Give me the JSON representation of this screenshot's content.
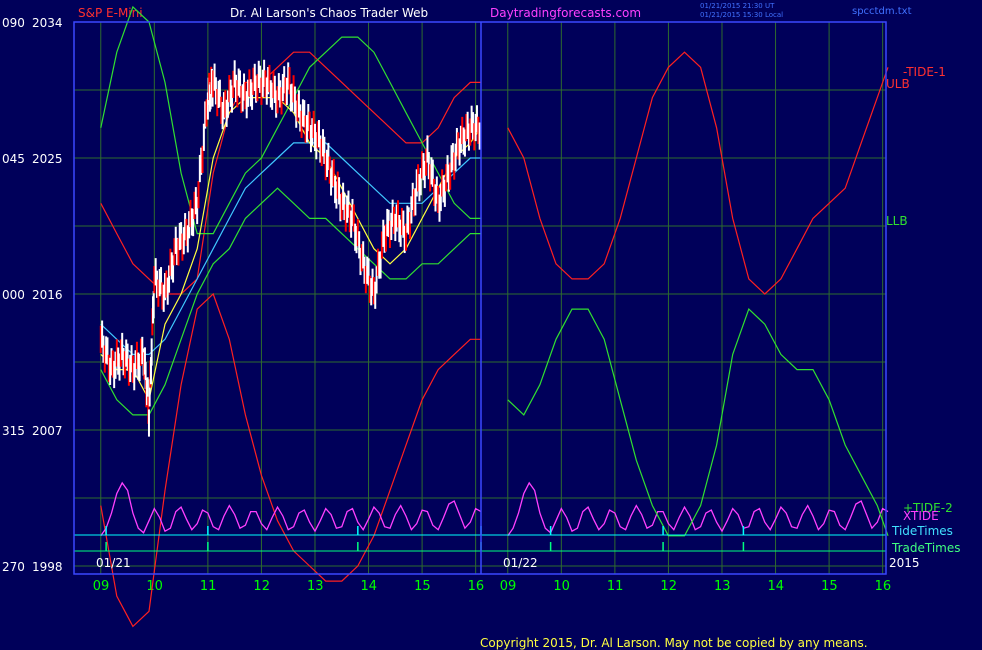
{
  "header": {
    "symbol": "S&P E-Mini",
    "title": "Dr. Al Larson's Chaos Trader Web",
    "site": "Daytradingforecasts.com",
    "timestamp_1": "01/21/2015 21:30 UT",
    "timestamp_2": "01/21/2015 15:30 Local",
    "file": "spcctdm.txt"
  },
  "copyright": "Copyright 2015, Dr. Al Larson. May not be copied by any means.",
  "colors": {
    "background": "#00005a",
    "grid": "#2e6b2e",
    "border": "#3a48ff",
    "price": "#ffffff",
    "down": "#ff0000",
    "red_line": "#ff2020",
    "green_line": "#30e030",
    "cyan_line": "#40c8ff",
    "yellow_line": "#ffff40",
    "magenta_line": "#ff40ff",
    "tide_times": "#00ffff",
    "trade_times": "#00ff80"
  },
  "chart_data": {
    "type": "line",
    "y_axis": {
      "price_ticks": [
        1998,
        2007,
        2016,
        2025,
        2034
      ],
      "angle_labels": [
        "270",
        "315",
        "000",
        "045",
        "090"
      ],
      "ylim": [
        1998,
        2034
      ]
    },
    "x_axis": {
      "hour_ticks": [
        "09",
        "10",
        "11",
        "12",
        "13",
        "14",
        "15",
        "16",
        "09",
        "10",
        "11",
        "12",
        "13",
        "14",
        "15",
        "16"
      ],
      "date_labels": [
        "01/21",
        "01/22"
      ],
      "year_label": "2015"
    },
    "series_labels": {
      "tide_1": "-TIDE-1",
      "ulb": "ULB",
      "llb": "LLB",
      "tide_2": "+TIDE-2",
      "xtide": "XTIDE",
      "tide_times": "TideTimes",
      "trade_times": "TradeTimes"
    },
    "series": [
      {
        "name": "-TIDE-1",
        "color": "#ff2020",
        "x": [
          9.0,
          9.3,
          9.6,
          9.9,
          10.2,
          10.5,
          10.8,
          11.1,
          11.4,
          11.7,
          12.0,
          12.3,
          12.6,
          12.9,
          13.2,
          13.5,
          13.8,
          14.1,
          14.4,
          14.7,
          15.0,
          15.3,
          15.6,
          15.9,
          16.1
        ],
        "values": [
          2002,
          1996,
          1994,
          1995,
          2003,
          2010,
          2015,
          2016,
          2013,
          2008,
          2004,
          2001,
          1999,
          1998,
          1997,
          1997,
          1998,
          2000,
          2003,
          2006,
          2009,
          2011,
          2012,
          2013,
          2013
        ]
      },
      {
        "name": "ULB",
        "color": "#ff2020",
        "x": [
          9.0,
          9.3,
          9.6,
          9.9,
          10.2,
          10.5,
          10.8,
          11.1,
          11.4,
          11.7,
          12.0,
          12.3,
          12.6,
          12.9,
          13.2,
          13.5,
          13.8,
          14.1,
          14.4,
          14.7,
          15.0,
          15.3,
          15.6,
          15.9,
          16.1
        ],
        "values": [
          2022,
          2020,
          2018,
          2017,
          2016,
          2016,
          2017,
          2024,
          2028,
          2030,
          2030,
          2031,
          2032,
          2032,
          2031,
          2030,
          2029,
          2028,
          2027,
          2026,
          2026,
          2027,
          2029,
          2030,
          2030
        ]
      },
      {
        "name": "LLB",
        "color": "#30e030",
        "x": [
          9.0,
          9.3,
          9.6,
          9.9,
          10.2,
          10.5,
          10.8,
          11.1,
          11.4,
          11.7,
          12.0,
          12.3,
          12.6,
          12.9,
          13.2,
          13.5,
          13.8,
          14.1,
          14.4,
          14.7,
          15.0,
          15.3,
          15.6,
          15.9,
          16.1
        ],
        "values": [
          2011,
          2009,
          2008,
          2008,
          2010,
          2013,
          2016,
          2018,
          2019,
          2021,
          2022,
          2023,
          2022,
          2021,
          2021,
          2020,
          2019,
          2018,
          2017,
          2017,
          2018,
          2018,
          2019,
          2020,
          2020
        ]
      },
      {
        "name": "+TIDE-2",
        "color": "#30e030",
        "x": [
          9.0,
          9.3,
          9.6,
          9.9,
          10.2,
          10.5,
          10.8,
          11.1,
          11.4,
          11.7,
          12.0,
          12.3,
          12.6,
          12.9,
          13.2,
          13.5,
          13.8,
          14.1,
          14.4,
          14.7,
          15.0,
          15.3,
          15.6,
          15.9,
          16.1
        ],
        "values": [
          2027,
          2032,
          2035,
          2034,
          2030,
          2024,
          2020,
          2020,
          2022,
          2024,
          2025,
          2027,
          2029,
          2031,
          2032,
          2033,
          2033,
          2032,
          2030,
          2028,
          2026,
          2024,
          2022,
          2021,
          2021
        ]
      },
      {
        "name": "Cyan",
        "color": "#40c8ff",
        "x": [
          9.0,
          9.3,
          9.6,
          9.9,
          10.2,
          10.5,
          10.8,
          11.1,
          11.4,
          11.7,
          12.0,
          12.3,
          12.6,
          12.9,
          13.2,
          13.5,
          13.8,
          14.1,
          14.4,
          14.7,
          15.0,
          15.3,
          15.6,
          15.9,
          16.1
        ],
        "values": [
          2014,
          2013,
          2012,
          2012,
          2013,
          2015,
          2017,
          2019,
          2021,
          2023,
          2024,
          2025,
          2026,
          2026,
          2026,
          2025,
          2024,
          2023,
          2022,
          2022,
          2022,
          2023,
          2024,
          2025,
          2025
        ]
      },
      {
        "name": "Yellow",
        "color": "#ffff40",
        "x": [
          9.0,
          9.3,
          9.6,
          9.9,
          10.2,
          10.5,
          10.8,
          11.1,
          11.4,
          11.7,
          12.0,
          12.3,
          12.6,
          12.9,
          13.2,
          13.5,
          13.8,
          14.1,
          14.4,
          14.7,
          15.0,
          15.3,
          15.6,
          15.9,
          16.1
        ],
        "values": [
          2012,
          2011,
          2011,
          2009,
          2014,
          2016,
          2019,
          2025,
          2028,
          2029,
          2029,
          2029,
          2028,
          2026,
          2025,
          2023,
          2021,
          2019,
          2018,
          2019,
          2021,
          2023,
          2025,
          2026,
          2027
        ]
      },
      {
        "name": "Price",
        "color": "#ffffff",
        "x": [
          9.0,
          9.2,
          9.4,
          9.6,
          9.8,
          9.9,
          10.0,
          10.2,
          10.4,
          10.6,
          10.8,
          11.0,
          11.1,
          11.3,
          11.5,
          11.7,
          11.9,
          12.1,
          12.3,
          12.5,
          12.7,
          12.9,
          13.1,
          13.3,
          13.5,
          13.7,
          13.9,
          14.1,
          14.3,
          14.5,
          14.7,
          14.9,
          15.1,
          15.3,
          15.5,
          15.7,
          15.9,
          16.1
        ],
        "values": [
          2013,
          2011,
          2012,
          2011,
          2012,
          2008,
          2017,
          2016,
          2019,
          2020,
          2022,
          2029,
          2030,
          2028,
          2030,
          2029,
          2030,
          2030,
          2029,
          2030,
          2028,
          2027,
          2026,
          2024,
          2022,
          2021,
          2018,
          2016,
          2020,
          2021,
          2020,
          2023,
          2025,
          2022,
          2024,
          2026,
          2027,
          2027
        ]
      },
      {
        "name": "XTIDE",
        "color": "#ff40ff",
        "x": [
          9.0,
          9.1,
          9.2,
          9.3,
          9.4,
          9.5,
          9.6,
          9.7,
          9.8,
          9.9,
          10.0,
          10.1,
          10.2,
          10.3,
          10.4,
          10.5,
          10.6,
          10.7,
          10.8,
          10.9,
          11.0,
          11.1,
          11.2,
          11.3,
          11.4,
          11.5,
          11.6,
          11.7,
          11.8,
          11.9,
          12.0,
          12.1,
          12.2,
          12.3,
          12.4,
          12.5,
          12.6,
          12.7,
          12.8,
          12.9,
          13.0,
          13.1,
          13.2,
          13.3,
          13.4,
          13.5,
          13.6,
          13.7,
          13.8,
          13.9,
          14.0,
          14.1,
          14.2,
          14.3,
          14.4,
          14.5,
          14.6,
          14.7,
          14.8,
          14.9,
          15.0,
          15.1,
          15.2,
          15.3,
          15.4,
          15.5,
          15.6,
          15.7,
          15.8,
          15.9,
          16.0,
          16.1
        ],
        "values": [
          2000,
          2000.5,
          2001.5,
          2002.8,
          2003.5,
          2003,
          2001.5,
          2000.5,
          2000.2,
          2001,
          2001.8,
          2001.2,
          2000.3,
          2000.5,
          2001.6,
          2001.9,
          2001.1,
          2000.4,
          2000.8,
          2001.7,
          2001.5,
          2000.6,
          2000.4,
          2001.3,
          2002.0,
          2001.4,
          2000.5,
          2000.7,
          2001.6,
          2001.6,
          2000.8,
          2000.4,
          2001.2,
          2001.9,
          2001.3,
          2000.4,
          2000.6,
          2001.5,
          2001.7,
          2000.9,
          2000.3,
          2001.0,
          2001.8,
          2001.4,
          2000.5,
          2000.6,
          2001.6,
          2001.8,
          2000.9,
          2000.4,
          2001.1,
          2001.9,
          2001.5,
          2000.6,
          2000.5,
          2001.4,
          2002.0,
          2001.3,
          2000.4,
          2000.8,
          2001.7,
          2001.6,
          2000.7,
          2000.4,
          2001.2,
          2002.1,
          2002.3,
          2001.4,
          2000.5,
          2000.9,
          2001.8,
          2001.6
        ]
      }
    ],
    "second_day_series": [
      {
        "name": "-TIDE-1",
        "color": "#ff2020",
        "x": [
          9.0,
          9.3,
          9.6,
          9.9,
          10.2,
          10.5,
          10.8,
          11.1,
          11.4,
          11.7,
          12.0,
          12.3,
          12.6,
          12.9,
          13.2,
          13.5,
          13.8,
          14.1,
          14.4,
          14.7,
          15.0,
          15.3,
          15.6,
          15.9,
          16.1
        ],
        "values": [
          2027,
          2025,
          2021,
          2018,
          2017,
          2017,
          2018,
          2021,
          2025,
          2029,
          2031,
          2032,
          2031,
          2027,
          2021,
          2017,
          2016,
          2017,
          2019,
          2021,
          2022,
          2023,
          2026,
          2029,
          2031
        ]
      },
      {
        "name": "+TIDE-2",
        "color": "#30e030",
        "x": [
          9.0,
          9.3,
          9.6,
          9.9,
          10.2,
          10.5,
          10.8,
          11.1,
          11.4,
          11.7,
          12.0,
          12.3,
          12.6,
          12.9,
          13.2,
          13.5,
          13.8,
          14.1,
          14.4,
          14.7,
          15.0,
          15.3,
          15.6,
          15.9,
          16.1
        ],
        "values": [
          2009,
          2008,
          2010,
          2013,
          2015,
          2015,
          2013,
          2009,
          2005,
          2002,
          2000,
          2000,
          2002,
          2006,
          2012,
          2015,
          2014,
          2012,
          2011,
          2011,
          2009,
          2006,
          2004,
          2002,
          2000
        ]
      }
    ]
  }
}
